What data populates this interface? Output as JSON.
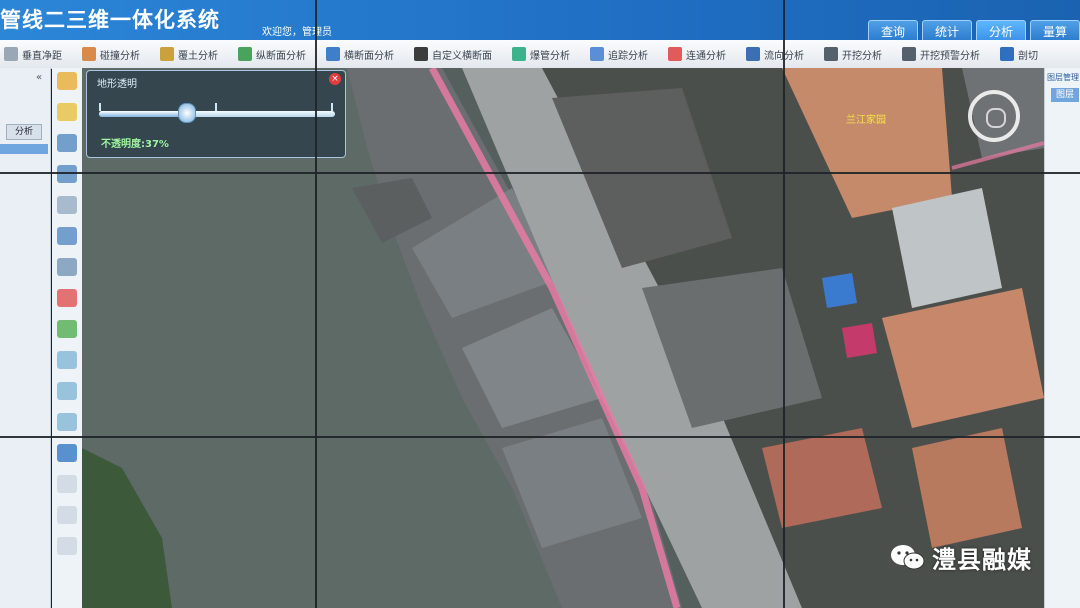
{
  "app": {
    "title": "管线二三维一体化系统",
    "welcome": "欢迎您，管理员"
  },
  "top_nav": [
    {
      "label": "查询",
      "active": false
    },
    {
      "label": "统计",
      "active": false
    },
    {
      "label": "分析",
      "active": true
    },
    {
      "label": "量算",
      "active": false
    }
  ],
  "toolbar": [
    {
      "label": "垂直净距",
      "icon": "vertical-distance-icon",
      "color": "#9aa7b4"
    },
    {
      "label": "碰撞分析",
      "icon": "collision-icon",
      "color": "#d88a4a"
    },
    {
      "label": "覆土分析",
      "icon": "cover-soil-icon",
      "color": "#c9a23d"
    },
    {
      "label": "纵断面分析",
      "icon": "longitudinal-section-icon",
      "color": "#4aa35c"
    },
    {
      "label": "横断面分析",
      "icon": "cross-section-icon",
      "color": "#3e7fc7"
    },
    {
      "label": "自定义横断面",
      "icon": "custom-section-icon",
      "color": "#3c3c3c"
    },
    {
      "label": "爆管分析",
      "icon": "pipe-burst-icon",
      "color": "#3db38c"
    },
    {
      "label": "追踪分析",
      "icon": "trace-icon",
      "color": "#5a8fd6"
    },
    {
      "label": "连通分析",
      "icon": "connectivity-icon",
      "color": "#e25b5b"
    },
    {
      "label": "流向分析",
      "icon": "flow-direction-icon",
      "color": "#3b6fb3"
    },
    {
      "label": "开挖分析",
      "icon": "excavation-icon",
      "color": "#54606c"
    },
    {
      "label": "开挖预警分析",
      "icon": "excavation-warning-icon",
      "color": "#54606c"
    },
    {
      "label": "剖切",
      "icon": "section-cut-icon",
      "color": "#2f6fc0"
    }
  ],
  "left_panel": {
    "collapse_glyph": "«",
    "analysis_button": "分析"
  },
  "opacity_panel": {
    "title": "地形透明",
    "value_text": "不透明度:37%",
    "value": 0.37,
    "close_glyph": "×"
  },
  "map": {
    "label": "兰江家园"
  },
  "right_panel": {
    "header": "图层管理",
    "tab": "图层"
  },
  "watermark": {
    "text": "澧县融媒"
  },
  "colors": {
    "header_blue": "#1f6ec3",
    "road_pink": "#e87ba3",
    "water": "#5e6a66",
    "label_yellow": "#f7e545"
  }
}
